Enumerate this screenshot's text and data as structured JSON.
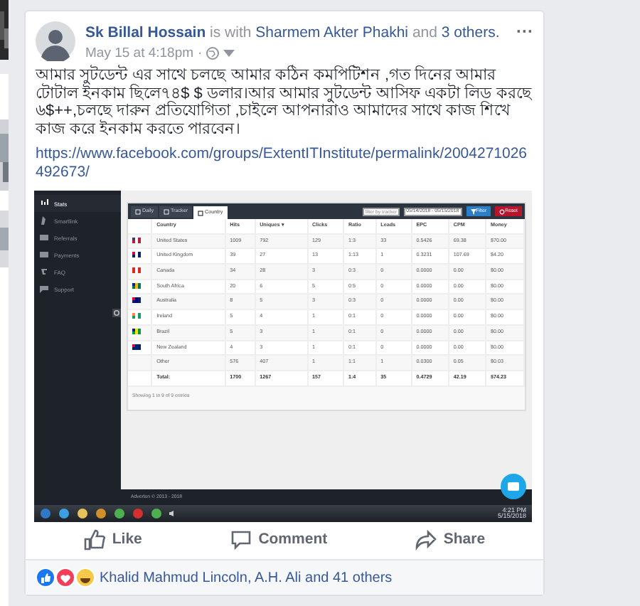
{
  "post": {
    "author": "Sk Billal Hossain",
    "with_word": "is with",
    "tagged": "Sharmem Akter Phakhi",
    "and_word": "and",
    "others": "3 others.",
    "time": "May 15 at 4:18pm",
    "separator": "·",
    "more": "···",
    "text": "আমার সুটডেন্ট এর সাথে চলছে আমার কঠিন কমপিটিশন ,গত দিনের আমার টোটাল ইনকাম ছিলে৭৪$ $ ডলার।আর আমার সুটডেন্ট আসিফ একটা লিড করছে ৬$++,চলছে দারুন প্রতিযোগিতা ,চাইলে আপনারাও আমাদের সাথে কাজ শিখে কাজ করে ইনকাম করতে পারবেন।",
    "link": "https://www.facebook.com/groups/ExtentITInstitute/permalink/2004271026492673/"
  },
  "screenshot": {
    "sidebar": [
      {
        "label": "Stats",
        "selected": true
      },
      {
        "label": "Smartlink",
        "selected": false
      },
      {
        "label": "Referrals",
        "selected": false
      },
      {
        "label": "Payments",
        "selected": false
      },
      {
        "label": "FAQ",
        "selected": false
      },
      {
        "label": "Support",
        "selected": false
      }
    ],
    "tabs": [
      {
        "label": "Daily",
        "selected": false
      },
      {
        "label": "Tracker",
        "selected": false
      },
      {
        "label": "Country",
        "selected": true
      }
    ],
    "tracker_filter": {
      "placeholder": "filter by tracker"
    },
    "date_range": "05/14/2018 - 05/15/2018",
    "filter_button": "Filter",
    "reset_button": "Reset",
    "columns": [
      "Country",
      "Hits",
      "Uniques ▾",
      "Clicks",
      "Ratio",
      "Leads",
      "EPC",
      "CPM",
      "Money"
    ],
    "rows": [
      [
        "United States",
        "1009",
        "792",
        "129",
        "1:3",
        "33",
        "0.5426",
        "69.38",
        "$70.00"
      ],
      [
        "United Kingdom",
        "39",
        "27",
        "13",
        "1:13",
        "1",
        "0.3231",
        "107.69",
        "$4.20"
      ],
      [
        "Canada",
        "34",
        "28",
        "3",
        "0:3",
        "0",
        "0.0000",
        "0.00",
        "$0.00"
      ],
      [
        "South Africa",
        "20",
        "6",
        "5",
        "0:5",
        "0",
        "0.0000",
        "0.00",
        "$0.00"
      ],
      [
        "Australia",
        "8",
        "5",
        "3",
        "0:3",
        "0",
        "0.0000",
        "0.00",
        "$0.00"
      ],
      [
        "Ireland",
        "5",
        "4",
        "1",
        "0:1",
        "0",
        "0.0000",
        "0.00",
        "$0.00"
      ],
      [
        "Brazil",
        "5",
        "3",
        "1",
        "0:1",
        "0",
        "0.0000",
        "0.00",
        "$0.00"
      ],
      [
        "New Zealand",
        "4",
        "3",
        "1",
        "0:1",
        "0",
        "0.0000",
        "0.00",
        "$0.00"
      ],
      [
        "Other",
        "576",
        "407",
        "1",
        "1:1",
        "1",
        "0.0300",
        "0.05",
        "$0.03"
      ]
    ],
    "total_row": [
      "Total:",
      "1700",
      "1267",
      "157",
      "1:4",
      "35",
      "0.4729",
      "42.19",
      "$74.23"
    ],
    "entries_info": "Showing 1 to 9 of 9 entries",
    "footer": "Adverten © 2013 - 2018",
    "taskbar": {
      "time": "4:21 PM",
      "date": "5/15/2018"
    }
  },
  "actions": [
    {
      "label": "Like",
      "kind": "like"
    },
    {
      "label": "Comment",
      "kind": "comment"
    },
    {
      "label": "Share",
      "kind": "share"
    }
  ],
  "reactions": {
    "text": "Khalid Mahmud Lincoln, A.H. Ali and 41 others"
  }
}
